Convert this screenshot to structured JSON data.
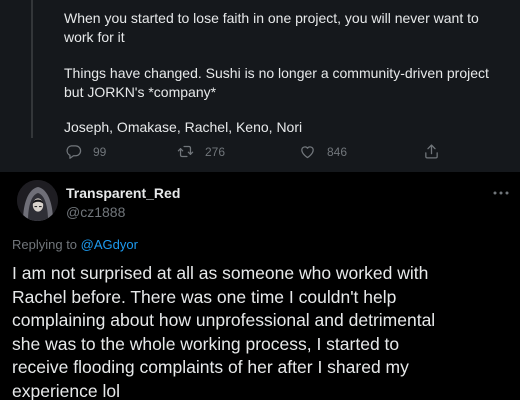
{
  "quoted_tweet": {
    "paragraphs": [
      "When you started to lose faith in one project, you will never want to work for it",
      "Things have changed. Sushi is no longer a community-driven project but JORKN's *company*",
      "Joseph, Omakase, Rachel, Keno, Nori"
    ],
    "actions": {
      "reply_count": "99",
      "retweet_count": "276",
      "like_count": "846"
    },
    "icons": {
      "reply": "reply-icon",
      "retweet": "retweet-icon",
      "like": "heart-icon",
      "share": "share-icon"
    }
  },
  "reply_tweet": {
    "display_name": "Transparent_Red",
    "handle": "@cz1888",
    "replying_prefix": "Replying to ",
    "replying_to": "@AGdyor",
    "body": "I am not surprised at all as someone who worked with\nRachel before. There was one time I couldn't help\ncomplaining about how unprofessional and detrimental\nshe was to the whole working process, I started to\nreceive flooding complaints of her after I shared my\nexperience lol",
    "avatar_icon": "hooded-figure-avatar",
    "more_icon": "more-options-icon"
  },
  "colors": {
    "background": "#000000",
    "quoted_background": "#15181c",
    "text_primary": "#e7e9ea",
    "text_secondary": "#71767b",
    "link": "#1d9bf0"
  }
}
